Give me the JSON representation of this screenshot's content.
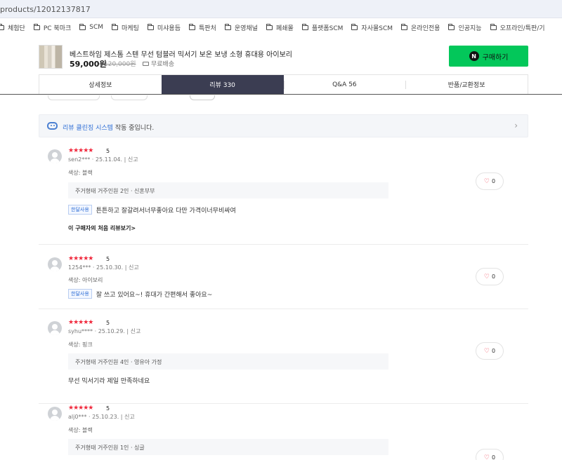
{
  "browser": {
    "url": "products/12012137817",
    "bookmarks": [
      "체험단",
      "PC 북마크",
      "SCM",
      "마케팅",
      "미샤용듬",
      "특판처",
      "운영채널",
      "폐쇄몰",
      "플랫폼SCM",
      "자사몰SCM",
      "온라인전용",
      "인공지능",
      "오프라인/특판/기"
    ]
  },
  "product": {
    "title": "베스트하임 제스톰 스텐 무선 텀블러 믹서기 보온 보냉 소형 휴대용 아이보리",
    "price": "59,000원",
    "original_price": "120,000원",
    "shipping": "무료배송",
    "buy_label": "구매하기",
    "buy_logo": "N",
    "buy_color": "#03c75a"
  },
  "tabs": [
    {
      "label": "상세정보",
      "active": false
    },
    {
      "label": "리뷰 330",
      "active": true
    },
    {
      "label": "Q&A 56",
      "active": false
    },
    {
      "label": "반품/교환정보",
      "active": false
    }
  ],
  "cleanbot": {
    "highlight": "리뷰 클린징 시스템",
    "rest": " 작동 중입니다.",
    "chevron": "›"
  },
  "reviews": [
    {
      "stars": "★★★★★",
      "score": "5",
      "user": "sen2***",
      "date": "25.11.04.",
      "report": "신고",
      "option": "색상: 블랙",
      "info": "주거형태 거주인원 2인 · 신혼부부",
      "badge": "한달사용",
      "text": "튼튼하고 잘갈려서너무좋아요 다만 가격이너무비싸여",
      "link": "이 구매자의 처음 리뷰보기>",
      "likes": "0"
    },
    {
      "stars": "★★★★★",
      "score": "5",
      "user": "1254***",
      "date": "25.10.30.",
      "report": "신고",
      "option": "색상: 아이보리",
      "badge": "한달사용",
      "text": "잘 쓰고 있어요~! 휴대가 간편해서 좋아요~",
      "likes": "0"
    },
    {
      "stars": "★★★★★",
      "score": "5",
      "user": "syhu****",
      "date": "25.10.29.",
      "report": "신고",
      "option": "색상: 핑크",
      "info": "주거형태 거주인원 4인 · 영유아 가정",
      "text": "무선 믹서기라 제일 만족하네요",
      "likes": "0"
    },
    {
      "stars": "★★★★★",
      "score": "5",
      "user": "alj0***",
      "date": "25.10.23.",
      "report": "신고",
      "option": "색상: 블랙",
      "info": "주거형태 거주인원 1인 · 싱글",
      "likes": "0"
    }
  ],
  "colors": {
    "accent_red": "#f0283c",
    "tab_active": "#3b3d52",
    "link_blue": "#2f6fd6"
  }
}
